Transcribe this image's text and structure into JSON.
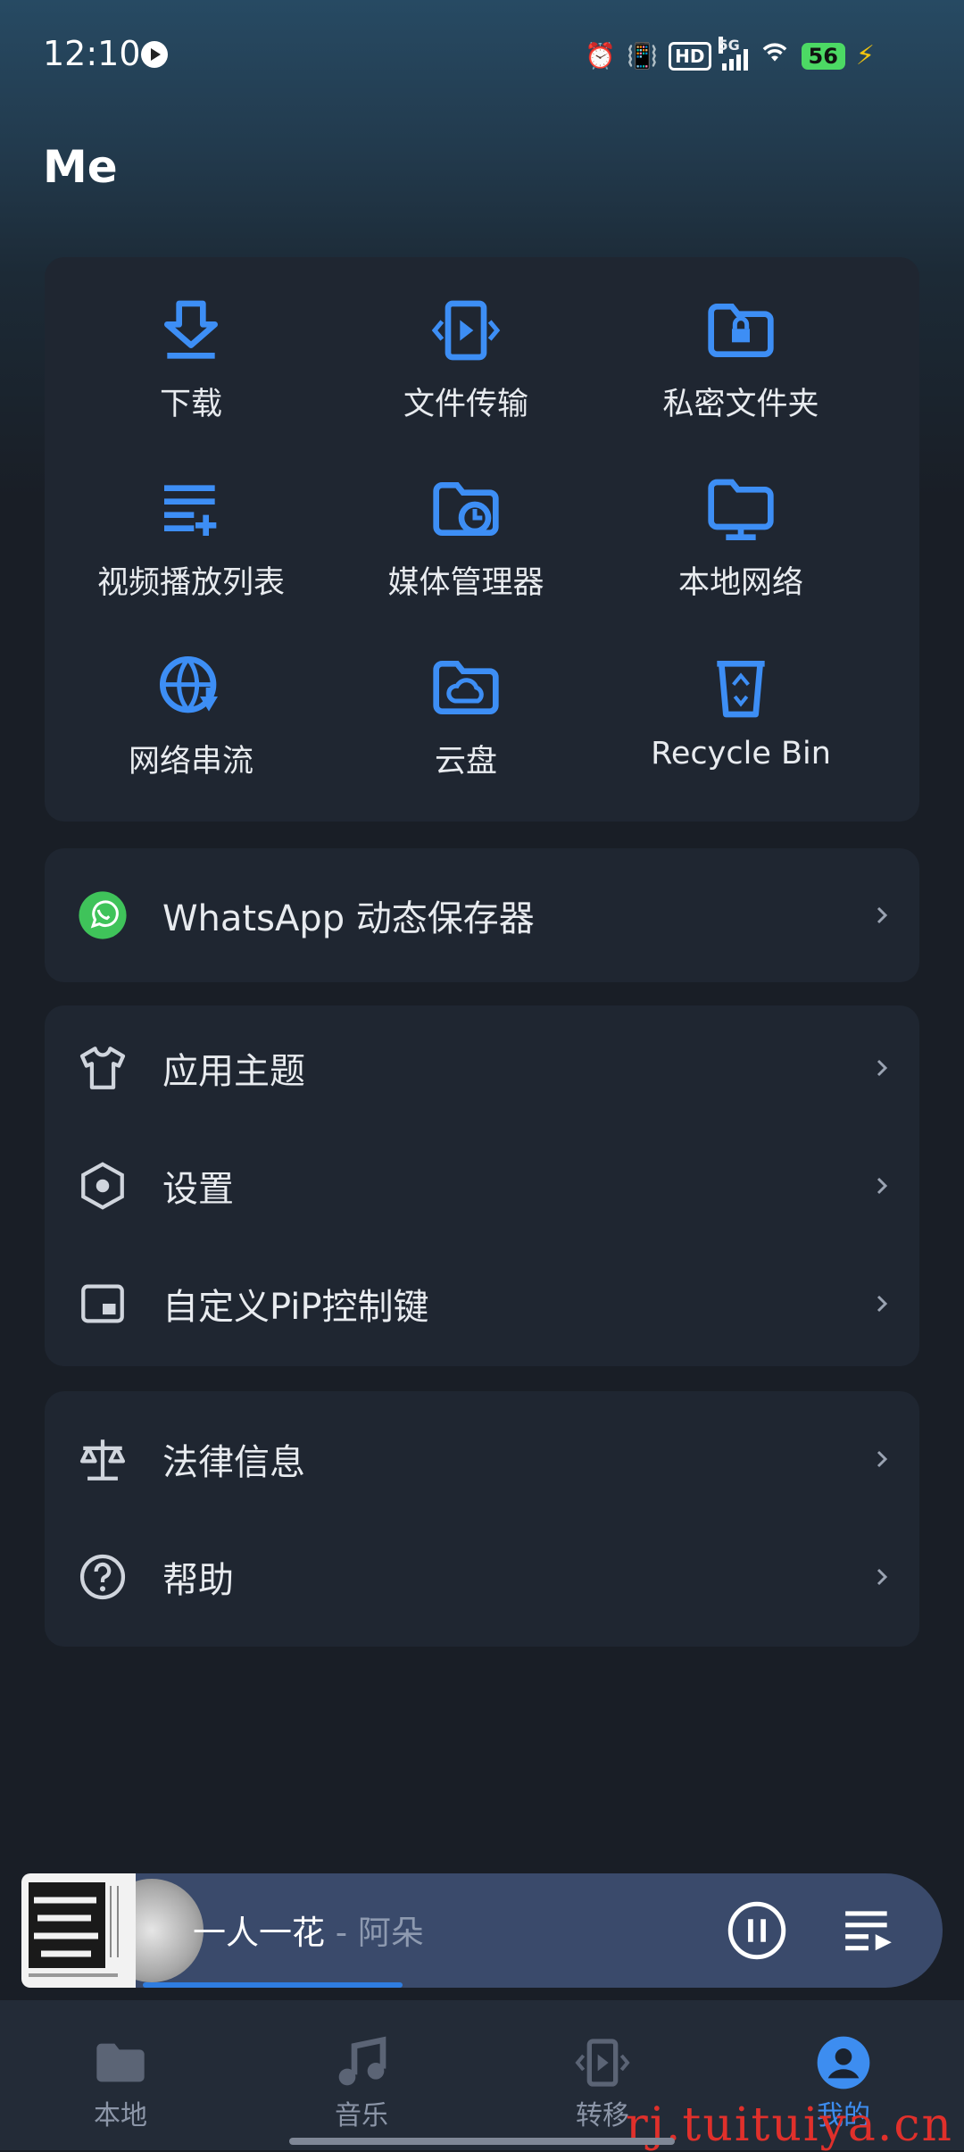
{
  "status_bar": {
    "time": "12:10",
    "network": "5G",
    "hd": "HD",
    "battery": "56"
  },
  "header": {
    "title": "Me"
  },
  "grid": [
    {
      "label": "下载",
      "icon": "download-icon"
    },
    {
      "label": "文件传输",
      "icon": "file-transfer-icon"
    },
    {
      "label": "私密文件夹",
      "icon": "private-folder-icon"
    },
    {
      "label": "视频播放列表",
      "icon": "video-playlist-icon"
    },
    {
      "label": "媒体管理器",
      "icon": "media-manager-icon"
    },
    {
      "label": "本地网络",
      "icon": "local-network-icon"
    },
    {
      "label": "网络串流",
      "icon": "network-stream-icon"
    },
    {
      "label": "云盘",
      "icon": "cloud-drive-icon"
    },
    {
      "label": "Recycle Bin",
      "icon": "recycle-bin-icon"
    }
  ],
  "whatsapp": {
    "label": "WhatsApp 动态保存器"
  },
  "preferences": [
    {
      "label": "应用主题",
      "icon": "shirt-icon"
    },
    {
      "label": "设置",
      "icon": "settings-hexagon-icon"
    },
    {
      "label": "自定义PiP控制键",
      "icon": "pip-icon"
    }
  ],
  "legal": [
    {
      "label": "法律信息",
      "icon": "scale-icon"
    },
    {
      "label": "帮助",
      "icon": "help-icon"
    }
  ],
  "player": {
    "song": "一人一花",
    "separator": " - ",
    "artist": "阿朵",
    "progress": 0.35
  },
  "nav": [
    {
      "label": "本地",
      "icon": "folder-icon",
      "active": false
    },
    {
      "label": "音乐",
      "icon": "music-note-icon",
      "active": false
    },
    {
      "label": "转移",
      "icon": "transfer-icon",
      "active": false
    },
    {
      "label": "我的",
      "icon": "profile-icon",
      "active": true
    }
  ],
  "watermark": "rj.tuituiya.cn",
  "colors": {
    "accent": "#3d8df0",
    "icon_blue": "#3d8ef5",
    "card": "#1f2631",
    "background": "#191e26",
    "whatsapp_green": "#3fc35a"
  }
}
